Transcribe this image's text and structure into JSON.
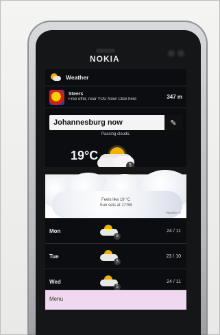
{
  "app": {
    "title": "Weather"
  },
  "ad": {
    "title": "Steers",
    "text": "Free offer, near YOU Now! Click here",
    "distance": "347 m"
  },
  "location": {
    "title": "Johannesburg now",
    "edit_icon": "pencil-icon"
  },
  "current": {
    "condition": "Passing clouds.",
    "temperature": "19°C",
    "feels_like": "Feels like 19 °C",
    "sunset": "Sun sets at 17:58",
    "source": "Weather ©"
  },
  "forecast": [
    {
      "day": "Mon",
      "temps": "24 / 11"
    },
    {
      "day": "Tue",
      "temps": "23 / 10"
    },
    {
      "day": "Wed",
      "temps": "24 / 11"
    }
  ],
  "menu": {
    "label": "Menu"
  },
  "device": {
    "brand": "NOKIA"
  }
}
